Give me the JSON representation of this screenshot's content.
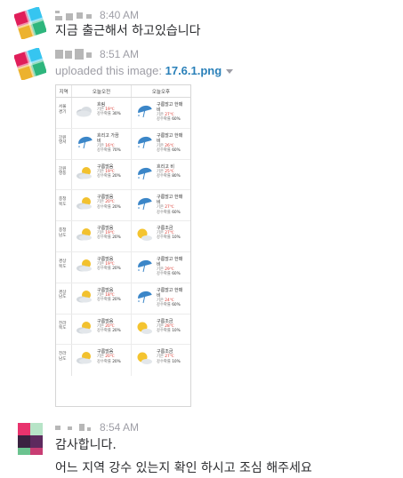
{
  "messages": [
    {
      "time": "8:40 AM",
      "text": "지금 출근해서 하고있습니다"
    },
    {
      "time": "8:51 AM",
      "upload_prefix": "uploaded this image:",
      "file_name": "17.6.1.png",
      "image": {
        "headers": [
          "지역",
          "오늘오전",
          "오늘오후"
        ],
        "temp_label": "기온",
        "rain_label": "강수확률",
        "rows": [
          {
            "region": "서울\n경기",
            "am": {
              "icon": "cloudy-icon",
              "cond": "흐림",
              "temp": "19℃",
              "rain": "30%"
            },
            "pm": {
              "icon": "umbrella-icon",
              "cond": "구름많고 한때\n비",
              "temp": "27℃",
              "rain": "60%"
            }
          },
          {
            "region": "강원\n영서",
            "am": {
              "icon": "umbrella-icon",
              "cond": "흐리고 가끔\n비",
              "temp": "16℃",
              "rain": "70%"
            },
            "pm": {
              "icon": "umbrella-icon",
              "cond": "구름많고 한때\n비",
              "temp": "26℃",
              "rain": "60%"
            }
          },
          {
            "region": "강원\n영동",
            "am": {
              "icon": "partly-cloudy-icon",
              "cond": "구름많음",
              "temp": "19℃",
              "rain": "20%"
            },
            "pm": {
              "icon": "umbrella-icon",
              "cond": "흐리고 비",
              "temp": "25℃",
              "rain": "80%"
            }
          },
          {
            "region": "충청\n북도",
            "am": {
              "icon": "partly-cloudy-icon",
              "cond": "구름많음",
              "temp": "20℃",
              "rain": "20%"
            },
            "pm": {
              "icon": "umbrella-icon",
              "cond": "구름많고 한때\n비",
              "temp": "27℃",
              "rain": "60%"
            }
          },
          {
            "region": "충청\n남도",
            "am": {
              "icon": "partly-cloudy-icon",
              "cond": "구름많음",
              "temp": "19℃",
              "rain": "20%"
            },
            "pm": {
              "icon": "partly-sunny-icon",
              "cond": "구름조금",
              "temp": "27℃",
              "rain": "10%"
            }
          },
          {
            "region": "경상\n북도",
            "am": {
              "icon": "partly-cloudy-icon",
              "cond": "구름많음",
              "temp": "19℃",
              "rain": "20%"
            },
            "pm": {
              "icon": "umbrella-icon",
              "cond": "구름많고 한때\n비",
              "temp": "29℃",
              "rain": "60%"
            }
          },
          {
            "region": "경상\n남도",
            "am": {
              "icon": "partly-cloudy-icon",
              "cond": "구름많음",
              "temp": "18℃",
              "rain": "20%"
            },
            "pm": {
              "icon": "umbrella-icon",
              "cond": "구름많고 한때\n비",
              "temp": "24℃",
              "rain": "60%"
            }
          },
          {
            "region": "전라\n북도",
            "am": {
              "icon": "partly-cloudy-icon",
              "cond": "구름많음",
              "temp": "20℃",
              "rain": "20%"
            },
            "pm": {
              "icon": "partly-sunny-icon",
              "cond": "구름조금",
              "temp": "28℃",
              "rain": "10%"
            }
          },
          {
            "region": "전라\n남도",
            "am": {
              "icon": "partly-cloudy-icon",
              "cond": "구름많음",
              "temp": "20℃",
              "rain": "20%"
            },
            "pm": {
              "icon": "partly-sunny-icon",
              "cond": "구름조금",
              "temp": "27℃",
              "rain": "10%"
            }
          }
        ]
      }
    },
    {
      "time": "8:54 AM",
      "lines": [
        "감사합니다.",
        "어느 지역 강수 있는지 확인 하시고 조심 해주세요"
      ]
    }
  ],
  "colors": {
    "text": "#2c2d30",
    "meta": "#9e9ea6",
    "link": "#2a80b9",
    "temp": "#d9322a"
  }
}
